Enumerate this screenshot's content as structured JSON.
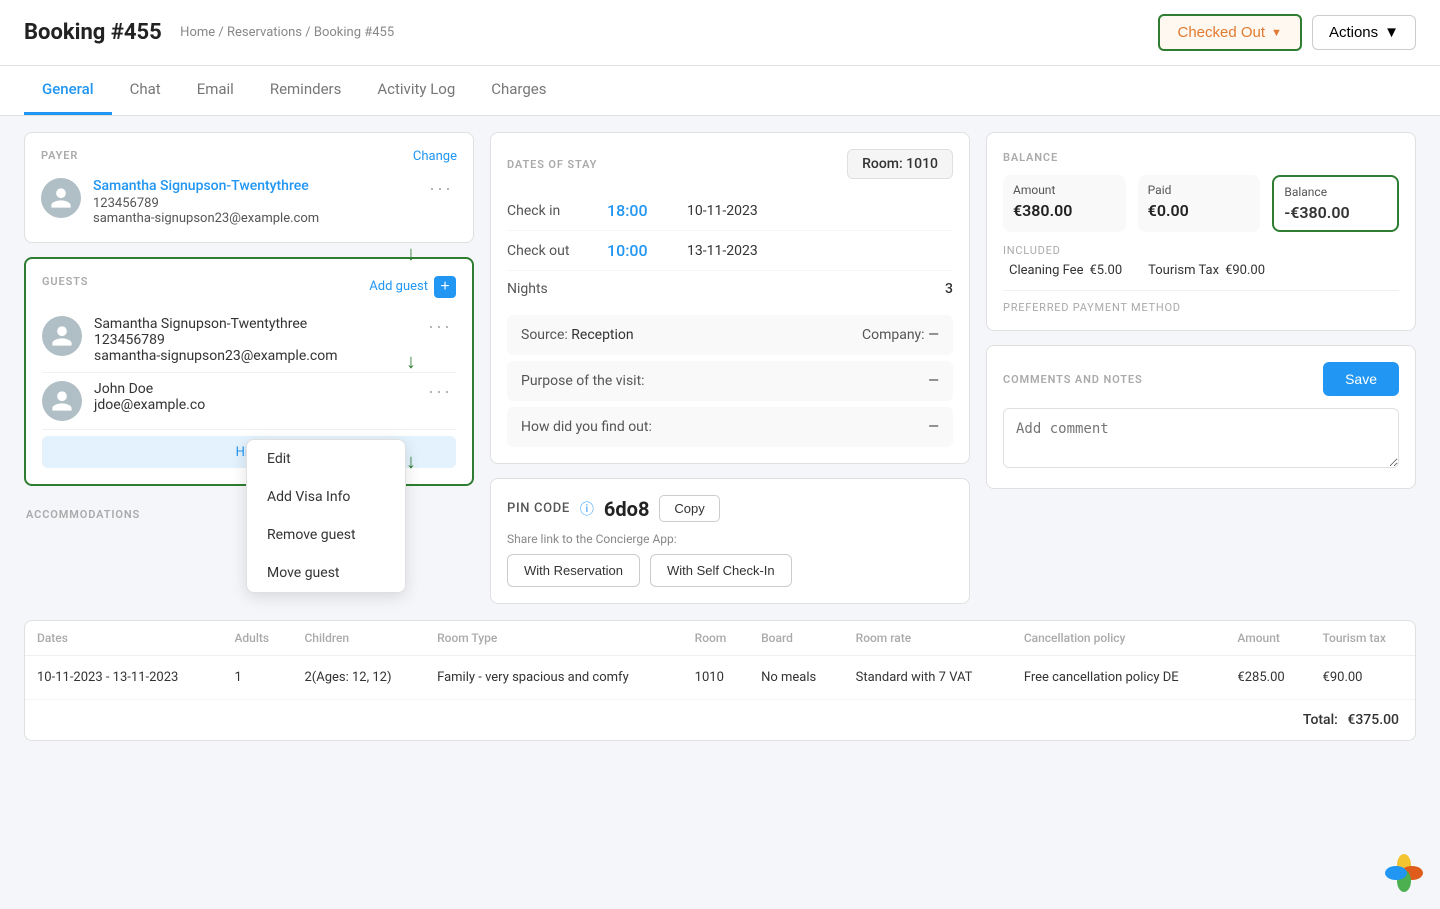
{
  "header": {
    "title": "Booking #455",
    "breadcrumb": [
      "Home",
      "Reservations",
      "Booking #455"
    ],
    "checked_out_label": "Checked Out",
    "actions_label": "Actions"
  },
  "tabs": [
    {
      "label": "General",
      "active": true
    },
    {
      "label": "Chat",
      "active": false
    },
    {
      "label": "Email",
      "active": false
    },
    {
      "label": "Reminders",
      "active": false
    },
    {
      "label": "Activity Log",
      "active": false
    },
    {
      "label": "Charges",
      "active": false
    }
  ],
  "payer": {
    "section_label": "PAYER",
    "change_label": "Change",
    "name": "Samantha Signupson-Twentythree",
    "phone": "123456789",
    "email": "samantha-signupson23@example.com"
  },
  "guests": {
    "section_label": "GUESTS",
    "add_guest_label": "Add guest",
    "list": [
      {
        "name": "Samantha Signupson-Twentythree",
        "phone": "123456789",
        "email": "samantha-signupson23@example.com"
      },
      {
        "name": "John Doe",
        "phone": "",
        "email": "jdoe@example.co"
      }
    ],
    "hide_label": "Hide"
  },
  "context_menu": {
    "items": [
      "Edit",
      "Add Visa Info",
      "Remove guest",
      "Move guest"
    ]
  },
  "dates": {
    "section_label": "DATES OF STAY",
    "room_label": "Room: 1010",
    "check_in_label": "Check in",
    "check_in_time": "18:00",
    "check_in_date": "10-11-2023",
    "check_out_label": "Check out",
    "check_out_time": "10:00",
    "check_out_date": "13-11-2023",
    "nights_label": "Nights",
    "nights_value": "3",
    "source_label": "Source:",
    "source_value": "Reception",
    "company_label": "Company:",
    "company_value": "—",
    "purpose_label": "Purpose of the visit:",
    "purpose_value": "—",
    "how_label": "How did you find out:",
    "how_value": "—"
  },
  "pin": {
    "label": "PIN CODE",
    "code": "6do8",
    "copy_label": "Copy",
    "share_label": "Share link to the Concierge App:",
    "btn1": "With Reservation",
    "btn2": "With Self Check-In"
  },
  "balance": {
    "section_label": "BALANCE",
    "amount_label": "Amount",
    "amount_value": "€380.00",
    "paid_label": "Paid",
    "paid_value": "€0.00",
    "balance_label": "Balance",
    "balance_value": "-€380.00",
    "included_label": "Included",
    "cleaning_label": "Cleaning Fee",
    "cleaning_value": "€5.00",
    "tourism_label": "Tourism Tax",
    "tourism_value": "€90.00",
    "preferred_label": "PREFERRED PAYMENT METHOD"
  },
  "comments": {
    "section_label": "COMMENTS AND NOTES",
    "save_label": "Save",
    "placeholder": "Add comment"
  },
  "accommodations": {
    "section_label": "ACCOMMODATIONS",
    "columns": [
      "Dates",
      "Adults",
      "Children",
      "Room Type",
      "Room",
      "Board",
      "Room rate",
      "Cancellation policy",
      "Amount",
      "Tourism tax"
    ],
    "rows": [
      {
        "dates": "10-11-2023 - 13-11-2023",
        "adults": "1",
        "children": "2(Ages: 12, 12)",
        "room_type": "Family - very spacious and comfy",
        "room": "1010",
        "board": "No meals",
        "room_rate": "Standard with 7 VAT",
        "cancellation": "Free cancellation policy DE",
        "amount": "€285.00",
        "tourism_tax": "€90.00"
      }
    ],
    "total_label": "Total:",
    "total_value": "€375.00"
  }
}
